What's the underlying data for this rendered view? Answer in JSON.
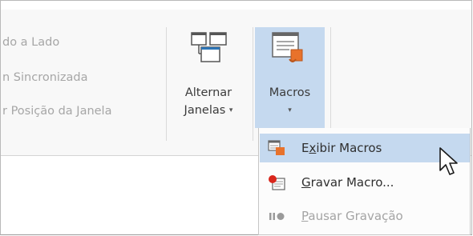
{
  "window_group": {
    "item1": "do a Lado",
    "item2": "n Sincronizada",
    "item3": "r Posição da Janela"
  },
  "alternar": {
    "line1": "Alternar",
    "line2": "Janelas",
    "caret": "▾"
  },
  "macros": {
    "label": "Macros",
    "caret": "▾"
  },
  "menu": {
    "exibir": {
      "pre": "E",
      "ul": "x",
      "post": "ibir Macros"
    },
    "gravar": {
      "pre": "",
      "ul": "G",
      "post": "ravar Macro..."
    },
    "pausar": {
      "pre": "",
      "ul": "P",
      "post": "ausar Gravação"
    }
  },
  "colors": {
    "highlight": "#c5d9ef",
    "macro_orange": "#e8722b",
    "record_red": "#d9261c"
  }
}
